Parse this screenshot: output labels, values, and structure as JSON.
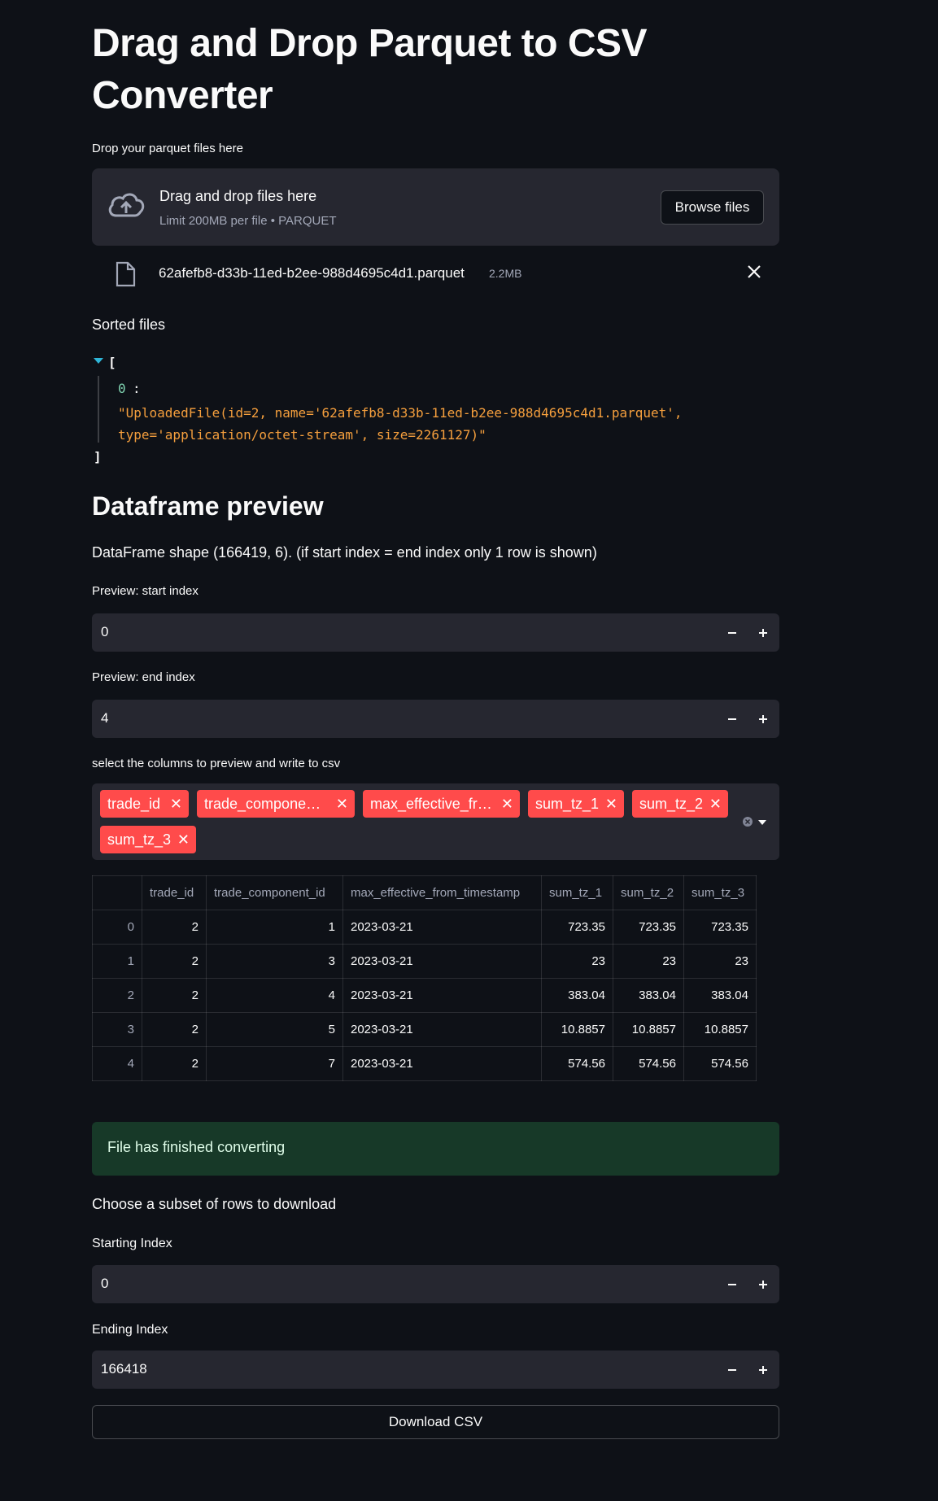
{
  "page": {
    "title": "Drag and Drop Parquet to CSV Converter"
  },
  "uploader": {
    "label": "Drop your parquet files here",
    "drop_text": "Drag and drop files here",
    "limit_text": "Limit 200MB per file • PARQUET",
    "browse_label": "Browse files",
    "icon": "cloud-upload-icon"
  },
  "uploaded_file": {
    "name": "62afefb8-d33b-11ed-b2ee-988d4695c4d1.parquet",
    "size": "2.2MB",
    "icon": "file-icon",
    "remove_icon": "close-icon"
  },
  "sorted_files": {
    "label": "Sorted files",
    "open_bracket": "[",
    "close_bracket": "]",
    "key": "0",
    "colon": ":",
    "value": "\"UploadedFile(id=2, name='62afefb8-d33b-11ed-b2ee-988d4695c4d1.parquet', type='application/octet-stream', size=2261127)\""
  },
  "preview": {
    "heading": "Dataframe preview",
    "shape_text": "DataFrame shape (166419, 6). (if start index = end index only 1 row is shown)",
    "start_label": "Preview: start index",
    "start_value": "0",
    "end_label": "Preview: end index",
    "end_value": "4",
    "columns_label": "select the columns to preview and write to csv",
    "selected_columns": [
      "trade_id",
      "trade_compone…",
      "max_effective_fr…",
      "sum_tz_1",
      "sum_tz_2",
      "sum_tz_3"
    ]
  },
  "table": {
    "headers": [
      "",
      "trade_id",
      "trade_component_id",
      "max_effective_from_timestamp",
      "sum_tz_1",
      "sum_tz_2",
      "sum_tz_3"
    ],
    "rows": [
      [
        "0",
        "2",
        "1",
        "2023-03-21",
        "723.35",
        "723.35",
        "723.35"
      ],
      [
        "1",
        "2",
        "3",
        "2023-03-21",
        "23",
        "23",
        "23"
      ],
      [
        "2",
        "2",
        "4",
        "2023-03-21",
        "383.04",
        "383.04",
        "383.04"
      ],
      [
        "3",
        "2",
        "5",
        "2023-03-21",
        "10.8857",
        "10.8857",
        "10.8857"
      ],
      [
        "4",
        "2",
        "7",
        "2023-03-21",
        "574.56",
        "574.56",
        "574.56"
      ]
    ]
  },
  "status": {
    "message": "File has finished converting",
    "color": "#173928"
  },
  "download": {
    "subset_label": "Choose a subset of rows to download",
    "start_label": "Starting Index",
    "start_value": "0",
    "end_label": "Ending Index",
    "end_value": "166418",
    "button_label": "Download CSV"
  },
  "colors": {
    "background": "#0e1117",
    "widget": "#262730",
    "accent": "#ff4b4b",
    "json_value": "#f59f3d",
    "json_key": "#7fd2b0"
  }
}
